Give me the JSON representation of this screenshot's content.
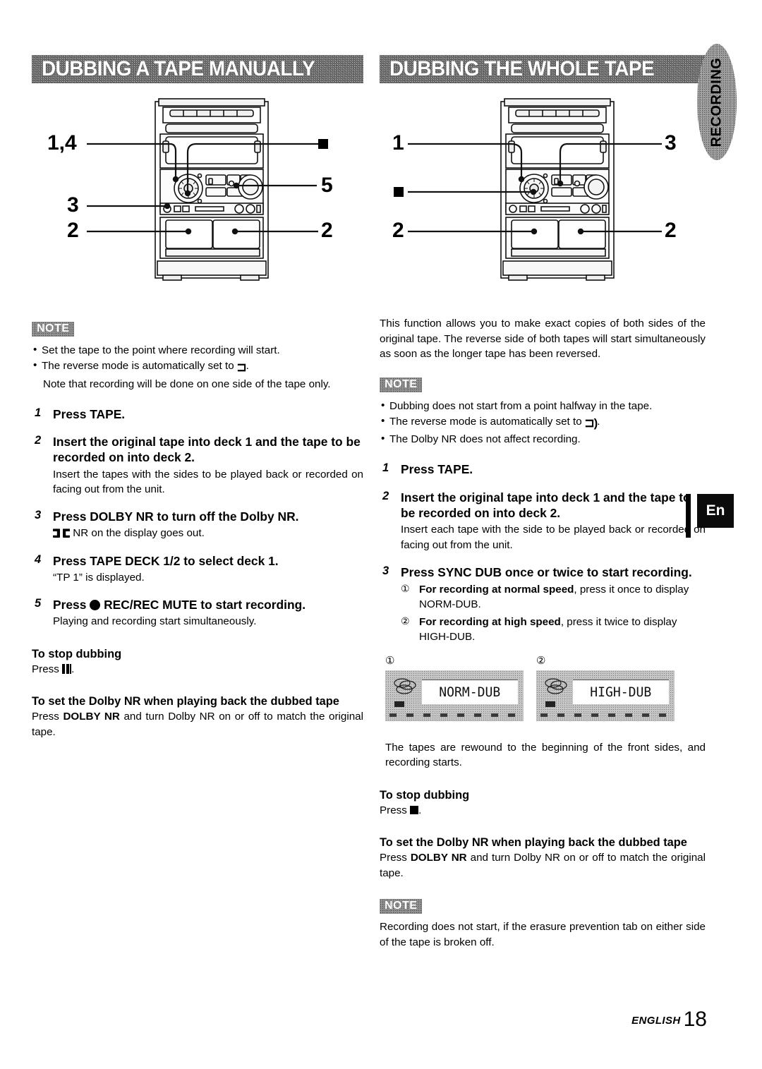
{
  "page": {
    "footer_label": "ENGLISH",
    "footer_page": "18"
  },
  "tabs": {
    "recording": "RECORDING",
    "language": "En"
  },
  "left_section": {
    "banner_title": "DUBBING A TAPE MANUALLY",
    "diagram": {
      "callouts": [
        "1,4",
        "3",
        "2",
        "5",
        "2"
      ],
      "stop_symbol_name": "stop-square"
    },
    "note": {
      "badge": "NOTE",
      "items": [
        "Set the tape to the point where recording will start.",
        "The reverse mode is automatically set to",
        "Note that recording will be done on one side of the tape only."
      ],
      "reverse_mode_symbol": "⊐"
    },
    "steps": [
      {
        "num": "1",
        "head": "Press TAPE.",
        "sub": ""
      },
      {
        "num": "2",
        "head": "Insert the original tape into deck 1 and the tape to be recorded on into deck 2.",
        "sub": "Insert the tapes with the sides to be played back or recorded on facing out from the unit."
      },
      {
        "num": "3",
        "head": "Press DOLBY NR to turn off the Dolby NR.",
        "sub_prefix": "",
        "sub": "NR on the display goes out.",
        "sub_icon": "dolby-double-d-icon"
      },
      {
        "num": "4",
        "head": "Press TAPE DECK 1/2 to select deck 1.",
        "sub": "“TP 1” is displayed."
      },
      {
        "num": "5",
        "head_prefix": "Press",
        "head": "REC/REC MUTE to start recording.",
        "head_icon": "record-dot-icon",
        "sub": "Playing and recording start simultaneously."
      }
    ],
    "stop_dubbing": {
      "head": "To stop dubbing",
      "press_label": "Press",
      "icon": "pause-bars-icon",
      "trailing": "."
    },
    "dolby_playback": {
      "head": "To set the Dolby NR when playing back the dubbed tape",
      "body_before": "Press ",
      "body_bold": "DOLBY NR",
      "body_after": " and turn Dolby NR on or off to match the original tape."
    }
  },
  "right_section": {
    "banner_title": "DUBBING THE WHOLE TAPE",
    "diagram": {
      "callouts": [
        "1",
        "3",
        "2",
        "2"
      ],
      "stop_symbol_name": "stop-square"
    },
    "intro": "This function allows you to make exact copies of both sides of the original tape. The reverse side of both tapes will start simultaneously as soon as the longer tape has been reversed.",
    "note": {
      "badge": "NOTE",
      "items": [
        "Dubbing does not start from a point halfway in the tape.",
        "The reverse mode is automatically set to",
        "The Dolby NR does not affect recording."
      ],
      "reverse_mode_symbol": "⊐)"
    },
    "steps": [
      {
        "num": "1",
        "head": "Press TAPE.",
        "sub": ""
      },
      {
        "num": "2",
        "head": "Insert the original tape into deck 1 and the tape to be recorded on into deck 2.",
        "sub": "Insert each tape with the side to be played back or recorded on facing out from the unit."
      },
      {
        "num": "3",
        "head": "Press SYNC DUB once or twice to start recording.",
        "substeps": [
          {
            "marker": "①",
            "bold": "For recording at normal speed",
            "rest": ", press it once to display NORM-DUB."
          },
          {
            "marker": "②",
            "bold": "For recording at high speed",
            "rest": ", press it twice to display HIGH-DUB."
          }
        ]
      }
    ],
    "displays": [
      {
        "marker": "①",
        "text": "NORM-DUB"
      },
      {
        "marker": "②",
        "text": "HIGH-DUB"
      }
    ],
    "after_displays": "The tapes are rewound to the beginning of the front sides, and recording starts.",
    "stop_dubbing": {
      "head": "To stop dubbing",
      "press_label": "Press",
      "icon": "stop-square-icon",
      "trailing": "."
    },
    "dolby_playback": {
      "head": "To set the Dolby NR when playing back the dubbed tape",
      "body_before": "Press ",
      "body_bold": "DOLBY NR",
      "body_after": " and turn Dolby NR on or off to match the original tape."
    },
    "final_note": {
      "badge": "NOTE",
      "body": "Recording does not start, if the erasure prevention tab on either side of the tape is broken off."
    }
  }
}
